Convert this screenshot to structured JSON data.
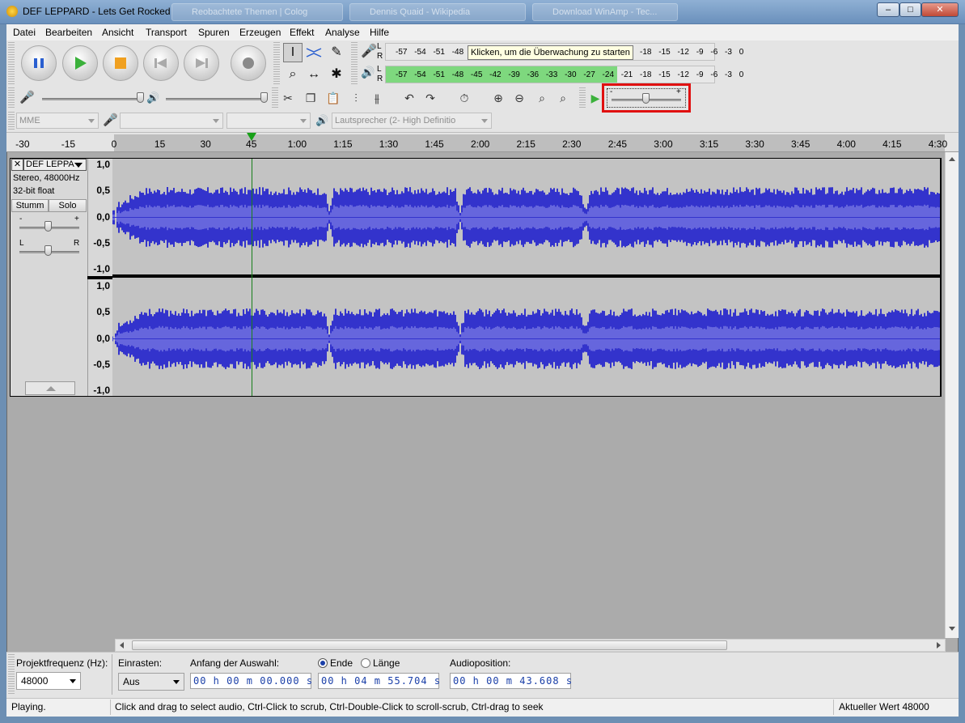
{
  "window": {
    "title": "DEF LEPPARD - Lets Get Rocked",
    "background_tabs": [
      "Reobachtete Themen | Colog",
      "Dennis Quaid - Wikipedia",
      "Download WinAmp - Tec..."
    ],
    "controls": {
      "minimize": "–",
      "maximize": "□",
      "close": "✕"
    }
  },
  "menu": [
    "Datei",
    "Bearbeiten",
    "Ansicht",
    "Transport",
    "Spuren",
    "Erzeugen",
    "Effekt",
    "Analyse",
    "Hilfe"
  ],
  "transport": {
    "buttons": [
      {
        "name": "pause",
        "icon": "pause-icon"
      },
      {
        "name": "play",
        "icon": "play-icon"
      },
      {
        "name": "stop",
        "icon": "stop-icon"
      },
      {
        "name": "skip-start",
        "icon": "skip-start-icon"
      },
      {
        "name": "skip-end",
        "icon": "skip-end-icon"
      },
      {
        "name": "record",
        "icon": "record-icon"
      }
    ]
  },
  "meters": {
    "record": {
      "channel_labels": [
        "L",
        "R"
      ],
      "scale": "-57 -54 -51 -48 -45 -42 -39 -36 -33 -30 -27 -24 -21 -18 -15 -12 -9 -6 -3 0",
      "tooltip": "Klicken, um die Überwachung zu starten"
    },
    "playback": {
      "channel_labels": [
        "L",
        "R"
      ],
      "scale": "-57 -54 -51 -48 -45 -42 -39 -36 -33 -30 -27 -24 -21 -18 -15 -12 -9 -6 -3 0",
      "fill_db": -18
    }
  },
  "mixer": {
    "recording_level": 1.0,
    "playback_level": 1.0,
    "speed_slider": {
      "min_label": "-",
      "max_label": "+",
      "value": 0.5
    }
  },
  "devices": {
    "host": "MME",
    "input": "",
    "channels": "",
    "output": "Lautsprecher (2- High Definitio"
  },
  "ruler": {
    "labels": [
      "-30",
      "-15",
      "0",
      "15",
      "30",
      "45",
      "1:00",
      "1:15",
      "1:30",
      "1:45",
      "2:00",
      "2:15",
      "2:30",
      "2:45",
      "3:00",
      "3:15",
      "3:30",
      "3:45",
      "4:00",
      "4:15",
      "4:30"
    ],
    "playhead_label": "45"
  },
  "track": {
    "name": "DEF LEPPA",
    "info1": "Stereo, 48000Hz",
    "info2": "32-bit float",
    "mute": "Stumm",
    "solo": "Solo",
    "gain_minus": "-",
    "gain_plus": "+",
    "pan_left": "L",
    "pan_right": "R",
    "vruler": [
      "1,0",
      "0,5",
      "0,0",
      "-0,5",
      "-1,0"
    ]
  },
  "waveform": {
    "color": "#3333cc",
    "rms_color": "#6666dd",
    "background": "#c3c3c3"
  },
  "selection": {
    "rate_label": "Projektfrequenz (Hz):",
    "rate_value": "48000",
    "snap_label": "Einrasten:",
    "snap_value": "Aus",
    "start_label": "Anfang der Auswahl:",
    "start_value": "00 h 00 m 00.000 s",
    "end_radio": "Ende",
    "length_radio": "Länge",
    "end_value": "00 h 04 m 55.704 s",
    "audiopos_label": "Audioposition:",
    "audiopos_value": "00 h 00 m 43.608 s"
  },
  "status": {
    "state": "Playing.",
    "hint": "Click and drag to select audio, Ctrl-Click to scrub, Ctrl-Double-Click to scroll-scrub, Ctrl-drag to seek",
    "rate": "Aktueller Wert 48000"
  },
  "highlight_color": "#e01010"
}
